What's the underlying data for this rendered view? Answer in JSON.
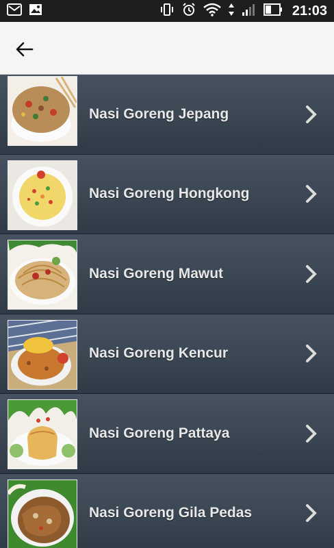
{
  "statusbar": {
    "time": "21:03"
  },
  "list": {
    "items": [
      {
        "title": "Nasi Goreng Jepang"
      },
      {
        "title": "Nasi Goreng Hongkong"
      },
      {
        "title": "Nasi Goreng Mawut"
      },
      {
        "title": "Nasi Goreng Kencur"
      },
      {
        "title": "Nasi Goreng Pattaya"
      },
      {
        "title": "Nasi Goreng Gila Pedas"
      }
    ]
  }
}
